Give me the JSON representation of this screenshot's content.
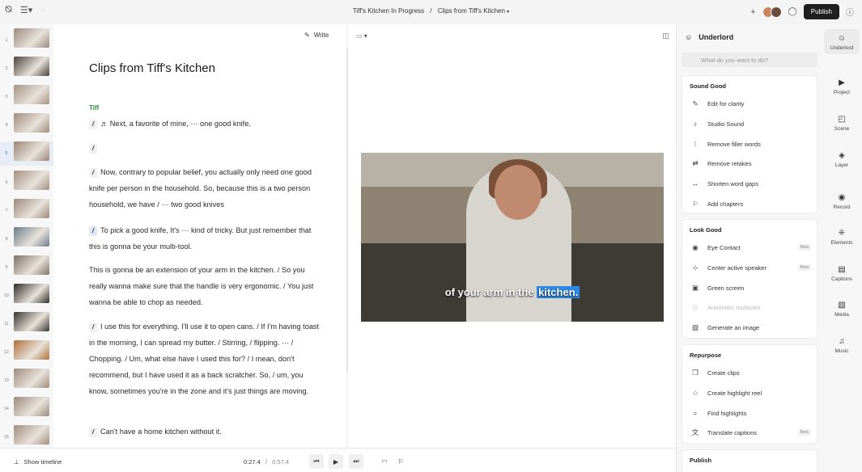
{
  "breadcrumb": {
    "project": "Tiff's Kitchen In Progress",
    "separator": "/",
    "composition": "Clips from Tiff's Kitchen"
  },
  "topbar": {
    "publish_label": "Publish"
  },
  "editor": {
    "write_label": "Write",
    "title": "Clips from Tiff's Kitchen",
    "speaker": "Tiff",
    "separator_glyph": "/",
    "paragraphs": [
      {
        "text": "♬  Next, a favorite of mine, ··· one good knife."
      },
      {
        "text": ""
      },
      {
        "text": "Now, contrary to popular belief, you actually only need one good knife per person in the household. So, because this is a two person household, we have  /  ··· two good knives"
      },
      {
        "text": "To pick a good knife, It's ··· kind of tricky. But just remember that this is gonna be your multi-tool."
      },
      {
        "text": "This is gonna be an extension of your arm in the kitchen.  /  So you really wanna make sure that the handle is very ergonomic.  /  You just wanna be able to chop as needed."
      },
      {
        "text": "I use this for everything. I'll use it to open cans.  /  If I'm having toast in the morning, I can spread my butter.  /  Stirring,  /  flipping. ···  /  Chopping.  /  Um, what else have I used this for?  /  I mean, don't recommend, but I have used it as a back scratcher. So,  /  um, you know, sometimes you're in the zone and it's just things are moving."
      },
      {
        "text": "Can't have a home kitchen without it."
      }
    ]
  },
  "scenes": [
    {
      "num": "1",
      "color": "#9b8a7e"
    },
    {
      "num": "2",
      "color": "#4a4038"
    },
    {
      "num": "3",
      "color": "#a69384"
    },
    {
      "num": "4",
      "color": "#a08b7c"
    },
    {
      "num": "5",
      "color": "#9a8576"
    },
    {
      "num": "6",
      "color": "#a38f80"
    },
    {
      "num": "7",
      "color": "#9c8879"
    },
    {
      "num": "8",
      "color": "#6a7c8a"
    },
    {
      "num": "9",
      "color": "#7d7064"
    },
    {
      "num": "10",
      "color": "#2e2a26"
    },
    {
      "num": "11",
      "color": "#3a3430"
    },
    {
      "num": "12",
      "color": "#b0703a"
    },
    {
      "num": "13",
      "color": "#a08c7e"
    },
    {
      "num": "14",
      "color": "#9d8a7c"
    },
    {
      "num": "15",
      "color": "#a18d7f"
    }
  ],
  "preview": {
    "caption_plain": "of your arm in the ",
    "caption_highlight": "kitchen."
  },
  "playback": {
    "show_timeline": "Show timeline",
    "current_time": "0:27.4",
    "separator": "/",
    "duration": "0:57.4"
  },
  "underlord": {
    "title": "Underlord",
    "search_placeholder": "What do you want to do?",
    "sound_good": {
      "title": "Sound Good",
      "items": [
        "Edit for clarity",
        "Studio Sound",
        "Remove filler words",
        "Remove retakes",
        "Shorten word gaps",
        "Add chapters"
      ]
    },
    "look_good": {
      "title": "Look Good",
      "items": [
        "Eye Contact",
        "Center active speaker",
        "Green screen",
        "Automatic multicam",
        "Generate an image"
      ],
      "beta": "Beta"
    },
    "repurpose": {
      "title": "Repurpose",
      "items": [
        "Create clips",
        "Create highlight reel",
        "Find highlights",
        "Translate captions"
      ],
      "beta": "Beta"
    },
    "publish": {
      "title": "Publish"
    }
  },
  "rail": [
    "Underlord",
    "Project",
    "Scene",
    "Layer",
    "Record",
    "Elements",
    "Captions",
    "Media",
    "Music"
  ]
}
